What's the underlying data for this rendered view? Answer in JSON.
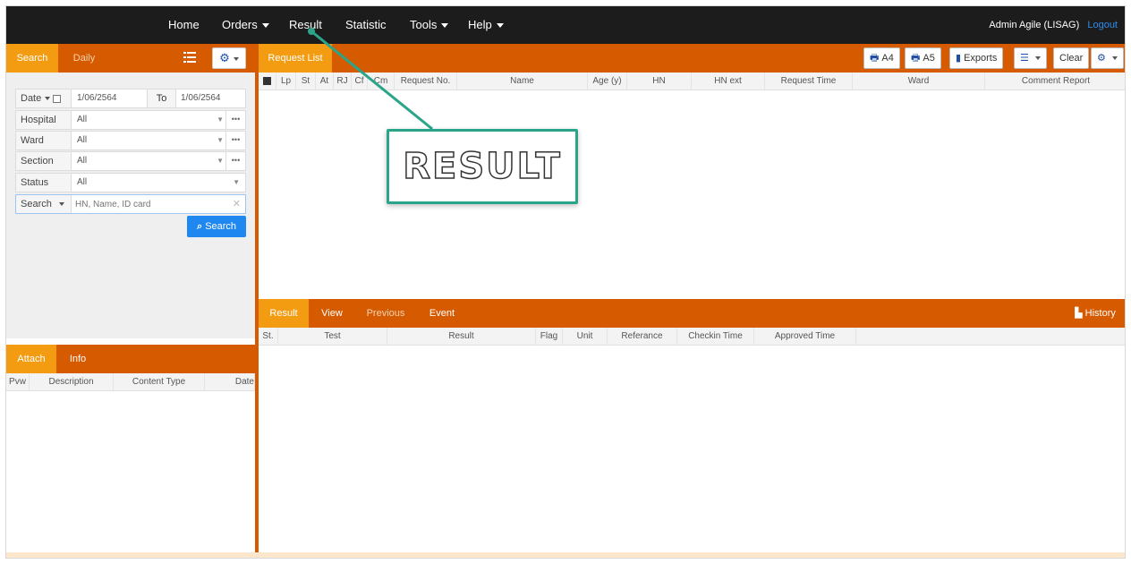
{
  "nav": {
    "items": [
      "Home",
      "Orders",
      "Result",
      "Statistic",
      "Tools",
      "Help"
    ],
    "user": "Admin Agile (LISAG)",
    "logout": "Logout"
  },
  "left": {
    "tabs": [
      "Search",
      "Daily"
    ],
    "date_label": "Date",
    "date_from": "1/06/2564",
    "to_label": "To",
    "date_to": "1/06/2564",
    "fields": [
      {
        "label": "Hospital",
        "value": "All"
      },
      {
        "label": "Ward",
        "value": "All"
      },
      {
        "label": "Section",
        "value": "All"
      },
      {
        "label": "Status",
        "value": "All"
      }
    ],
    "search_label": "Search",
    "search_placeholder": "HN, Name, ID card",
    "search_button": "Search",
    "attach_tabs": [
      "Attach",
      "Info"
    ],
    "attach_columns": [
      "Pvw",
      "Description",
      "Content Type",
      "Date"
    ]
  },
  "request": {
    "tab": "Request List",
    "toolbar": {
      "a4": "A4",
      "a5": "A5",
      "exports": "Exports",
      "clear": "Clear"
    },
    "columns": [
      "Lp",
      "St",
      "At",
      "RJ",
      "Cf",
      "Cm",
      "Request No.",
      "Name",
      "Age (y)",
      "HN",
      "HN ext",
      "Request Time",
      "Ward",
      "Comment Report"
    ]
  },
  "result": {
    "tabs": [
      "Result",
      "View",
      "Previous",
      "Event"
    ],
    "history": "History",
    "columns": [
      "St.",
      "Test",
      "Result",
      "Flag",
      "Unit",
      "Referance",
      "Checkin Time",
      "Approved Time"
    ]
  },
  "callout": {
    "text": "RESULT"
  },
  "colors": {
    "orange": "#d65a00",
    "active_tab": "#f39c12",
    "nav": "#1c1c1c",
    "teal": "#2aa58a",
    "primary": "#1e87f0"
  }
}
